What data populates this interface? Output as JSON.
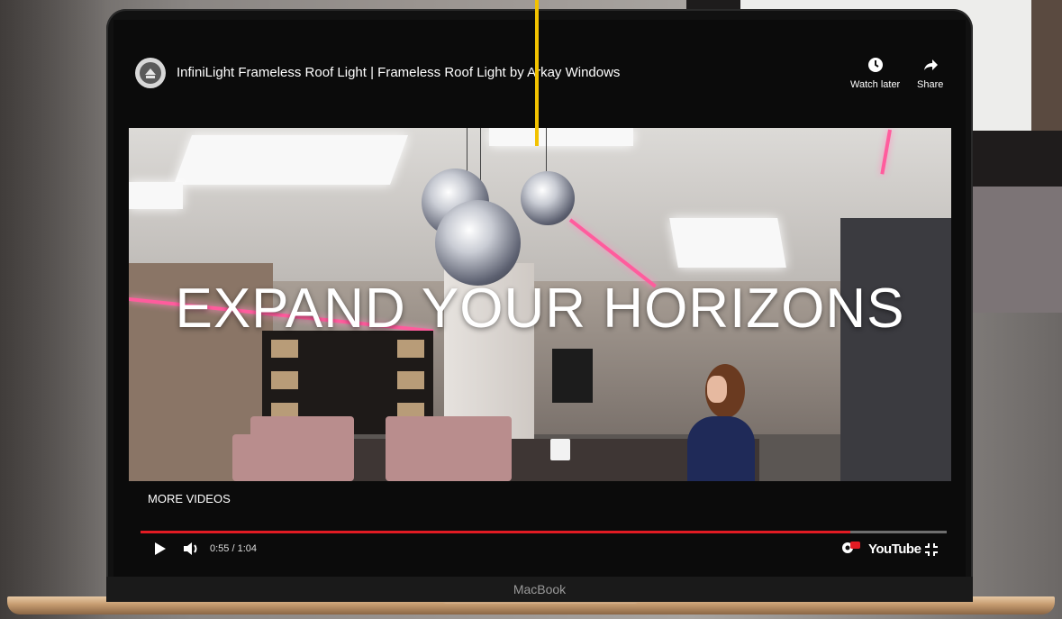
{
  "video": {
    "title": "InfiniLight Frameless Roof Light | Frameless Roof Light by Arkay Windows",
    "overlay_text": "EXPAND YOUR HORIZONS",
    "watch_later_label": "Watch later",
    "share_label": "Share",
    "more_videos_label": "MORE VIDEOS",
    "time_display": "0:55 / 1:04",
    "progress": 0.88,
    "brand_label": "YouTube"
  },
  "device": {
    "label": "MacBook"
  },
  "icons": {
    "channel_logo": "arkay-logo-icon",
    "watch_later": "clock-icon",
    "share": "share-arrow-icon",
    "play": "play-icon",
    "volume": "volume-icon",
    "settings": "settings-gear-icon",
    "fullscreen": "exit-fullscreen-icon"
  },
  "colors": {
    "progress_played": "#e21b23",
    "callout_line": "#f2c200",
    "accent_pink": "#ff5c9d"
  }
}
